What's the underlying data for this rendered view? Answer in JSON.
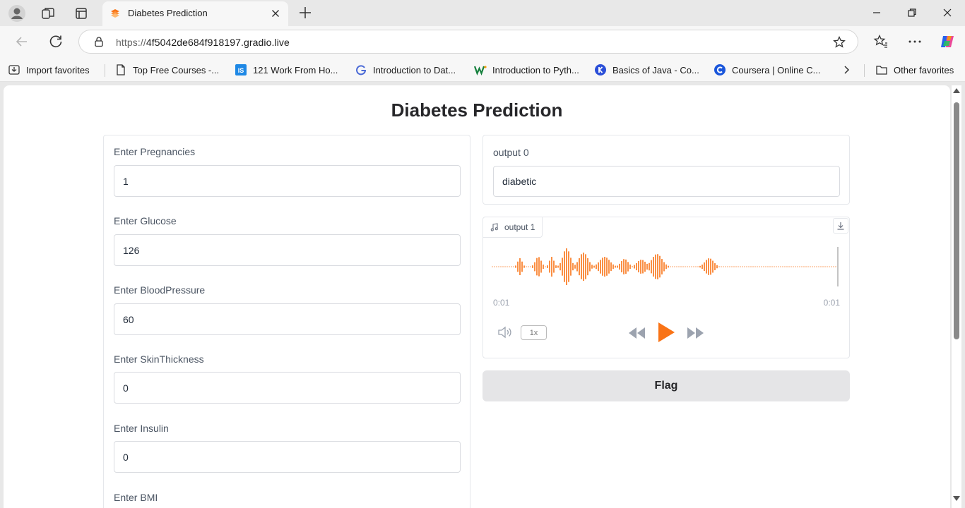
{
  "tab": {
    "title": "Diabetes Prediction"
  },
  "address": {
    "scheme": "https://",
    "host": "4f5042de684f918197.gradio.live"
  },
  "favorites": [
    {
      "label": "Import favorites",
      "icon": "import-icon"
    },
    {
      "label": "Top Free Courses -...",
      "icon": "page-icon"
    },
    {
      "label": "121 Work From Ho...",
      "icon": "is-logo-icon"
    },
    {
      "label": "Introduction to Dat...",
      "icon": "g-logo-icon"
    },
    {
      "label": "Introduction to Pyth...",
      "icon": "w-logo-icon"
    },
    {
      "label": "Basics of Java - Co...",
      "icon": "k-logo-icon"
    },
    {
      "label": "Coursera | Online C...",
      "icon": "coursera-icon"
    },
    {
      "label": "Other favorites",
      "icon": "folder-icon"
    }
  ],
  "app": {
    "title": "Diabetes Prediction",
    "inputs": [
      {
        "label": "Enter Pregnancies",
        "value": "1"
      },
      {
        "label": "Enter Glucose",
        "value": "126"
      },
      {
        "label": "Enter BloodPressure",
        "value": "60"
      },
      {
        "label": "Enter SkinThickness",
        "value": "0"
      },
      {
        "label": "Enter Insulin",
        "value": "0"
      },
      {
        "label": "Enter BMI",
        "value": ""
      }
    ],
    "output0": {
      "label": "output 0",
      "value": "diabetic"
    },
    "output1": {
      "label": "output 1",
      "time_start": "0:01",
      "time_end": "0:01",
      "rate": "1x"
    },
    "flag_label": "Flag"
  },
  "colors": {
    "accent": "#f97316",
    "border": "#e5e7eb"
  }
}
